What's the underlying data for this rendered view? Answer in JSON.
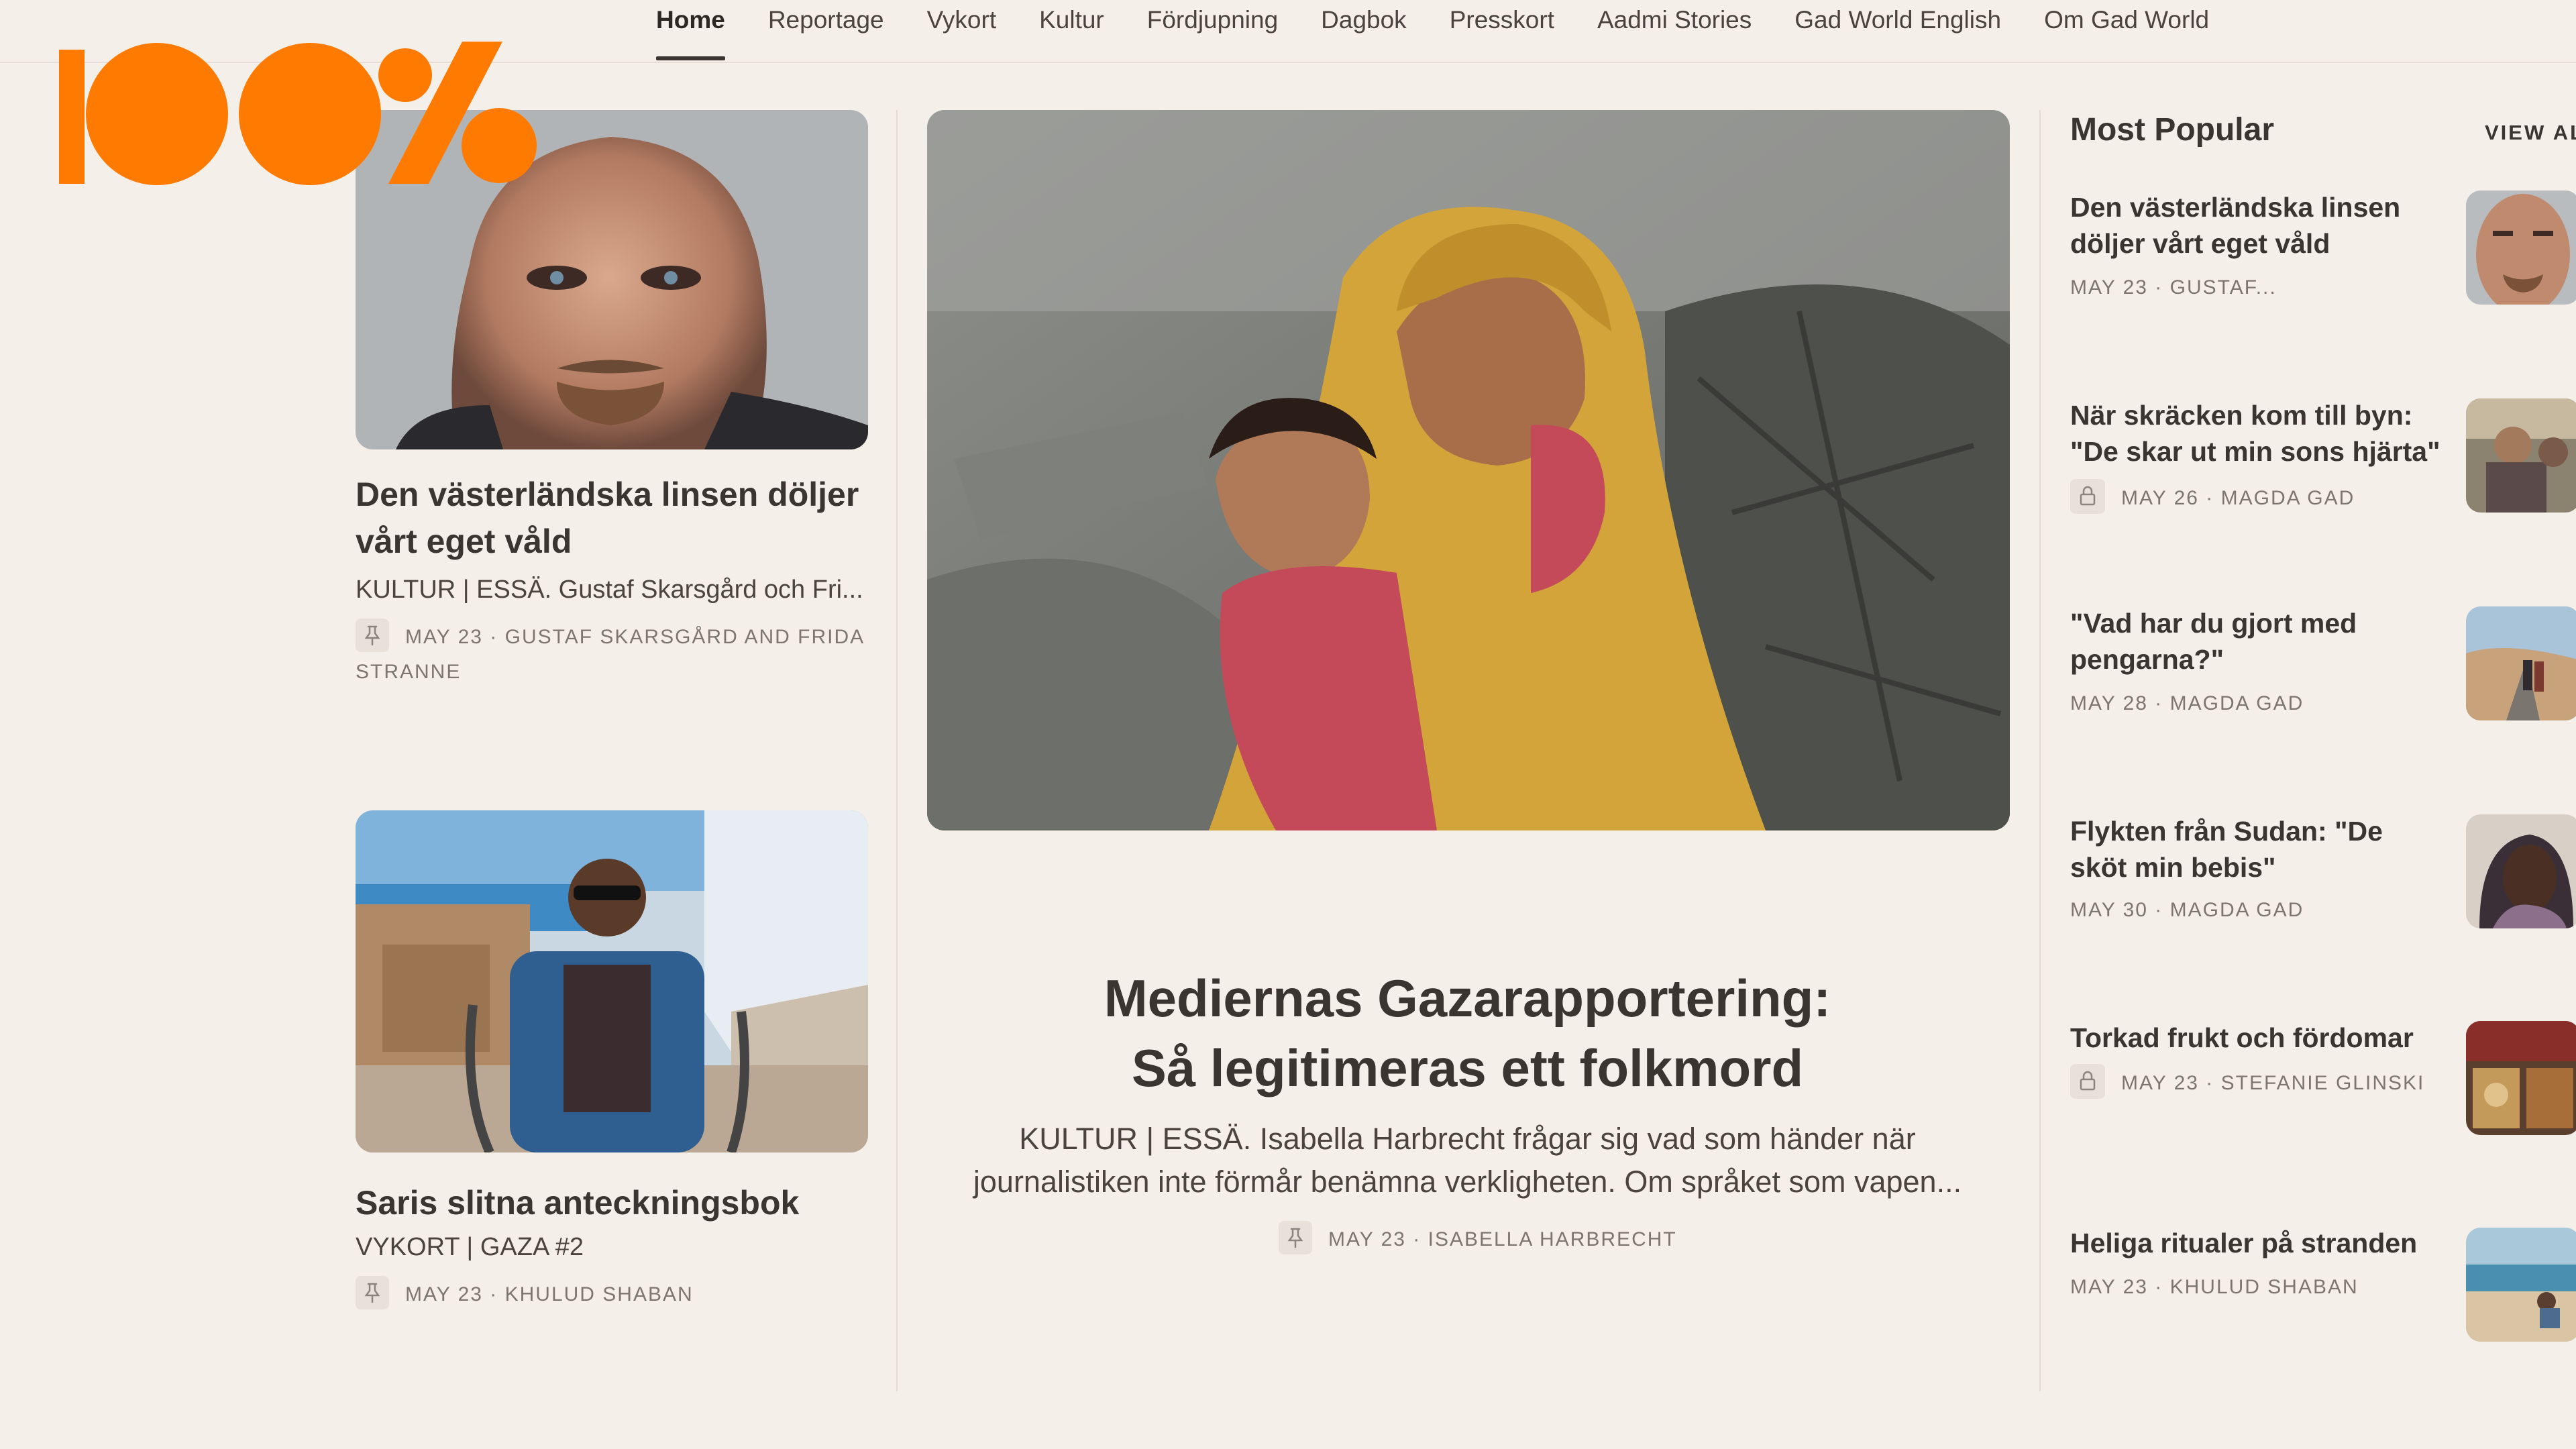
{
  "nav": {
    "items": [
      "Home",
      "Reportage",
      "Vykort",
      "Kultur",
      "Fördjupning",
      "Dagbok",
      "Presskort",
      "Aadmi Stories",
      "Gad World English",
      "Om Gad World"
    ],
    "active": "Home"
  },
  "logo": {
    "text": "100%",
    "color": "#ff7a00"
  },
  "left": {
    "story1": {
      "title": "Den västerländska linsen döljer vårt eget våld",
      "subtitle": "KULTUR | ESSÄ. Gustaf Skarsgård och Fri...",
      "meta_line1": "MAY 23 · GUSTAF SKARSGÅRD AND FRIDA",
      "meta_line2": "STRANNE"
    },
    "story2": {
      "title": "Saris slitna anteckningsbok",
      "subtitle": "VYKORT | GAZA #2",
      "meta": "MAY 23 · KHULUD SHABAN"
    }
  },
  "hero": {
    "title_line1": "Mediernas Gazarapportering:",
    "title_line2": "Så legitimeras ett folkmord",
    "sub_line1": "KULTUR | ESSÄ. Isabella Harbrecht frågar sig vad som händer när",
    "sub_line2": "journalistiken inte förmår benämna verkligheten. Om språket som vapen...",
    "meta": "MAY 23 · ISABELLA HARBRECHT"
  },
  "most_popular": {
    "heading": "Most Popular",
    "view_all": "VIEW ALL",
    "items": [
      {
        "title_1": "Den västerländska linsen",
        "title_2": "döljer vårt eget våld",
        "meta": "MAY 23 · GUSTAF..."
      },
      {
        "title_1": "När skräcken kom till byn:",
        "title_2": "\"De skar ut min sons hjärta\"",
        "meta": "MAY 26 · MAGDA GAD"
      },
      {
        "title_1": "\"Vad har du gjort med",
        "title_2": "pengarna?\"",
        "meta": "MAY 28 · MAGDA GAD"
      },
      {
        "title_1": "Flykten från Sudan: \"De",
        "title_2": "sköt min bebis\"",
        "meta": "MAY 30 · MAGDA GAD"
      },
      {
        "title_1": "Torkad frukt och fördomar",
        "title_2": "",
        "meta": "MAY 23 · STEFANIE GLINSKI"
      },
      {
        "title_1": "Heliga ritualer på stranden",
        "title_2": "",
        "meta": "MAY 23 · KHULUD SHABAN"
      }
    ]
  },
  "colors": {
    "background": "#f4efe9",
    "accent": "#ff7a00",
    "text": "#3b3531",
    "meta": "#7d756f"
  }
}
